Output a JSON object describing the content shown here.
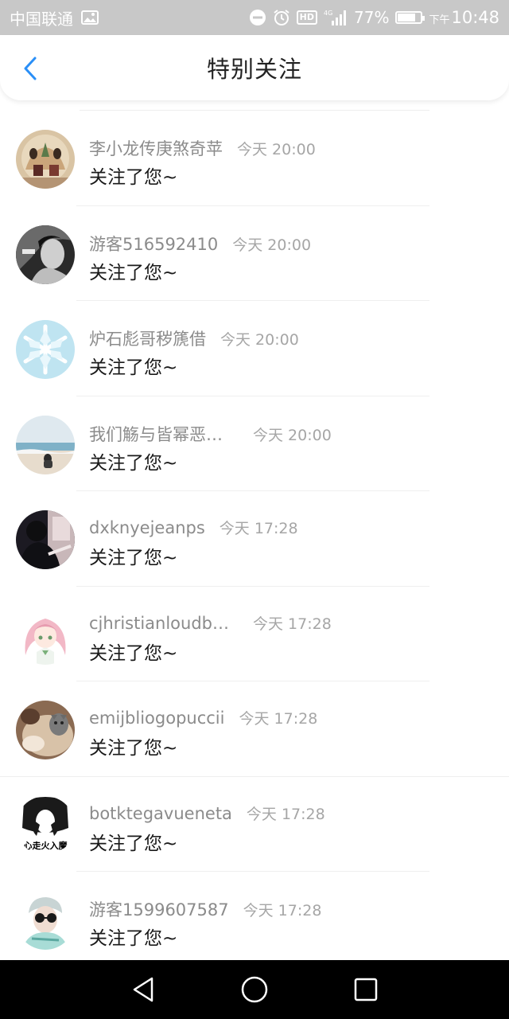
{
  "status_bar": {
    "carrier": "中国联通",
    "battery": "77%",
    "battery_level": 0.77,
    "network": "4G",
    "hd_label": "HD",
    "time_prefix": "下午",
    "time": "10:48",
    "icons": [
      "image-icon",
      "dnd-icon",
      "alarm-icon",
      "hd-icon",
      "signal-icon",
      "battery-icon"
    ]
  },
  "header": {
    "title": "特别关注",
    "back_icon": "chevron-left-icon",
    "accent_color": "#2a8ff7"
  },
  "items": [
    {
      "name": "李小龙传庚煞奇苹",
      "time": "今天 20:00",
      "message": "关注了您~",
      "avatar": "lanterns"
    },
    {
      "name": "游客516592410",
      "time": "今天 20:00",
      "message": "关注了您~",
      "avatar": "bw-portrait"
    },
    {
      "name": "炉石彪哥秽篪借",
      "time": "今天 20:00",
      "message": "关注了您~",
      "avatar": "snowflake"
    },
    {
      "name": "我们觞与皆幂恶的...",
      "time": "今天 20:00",
      "message": "关注了您~",
      "avatar": "beach"
    },
    {
      "name": "dxknyejeanps",
      "time": "今天 17:28",
      "message": "关注了您~",
      "avatar": "dark-photo"
    },
    {
      "name": "cjhristianloudbout...",
      "time": "今天 17:28",
      "message": "关注了您~",
      "avatar": "anime-girl"
    },
    {
      "name": "emijbliogopuccii",
      "time": "今天 17:28",
      "message": "关注了您~",
      "avatar": "cat"
    },
    {
      "name": "botktegavueneta",
      "time": "今天 17:28",
      "message": "关注了您~",
      "avatar": "sketch"
    },
    {
      "name": "游客1599607587",
      "time": "今天 17:28",
      "message": "关注了您~",
      "avatar": "sunglasses"
    }
  ],
  "nav_bar": {
    "buttons": [
      "back-triangle-icon",
      "home-circle-icon",
      "recents-square-icon"
    ]
  }
}
